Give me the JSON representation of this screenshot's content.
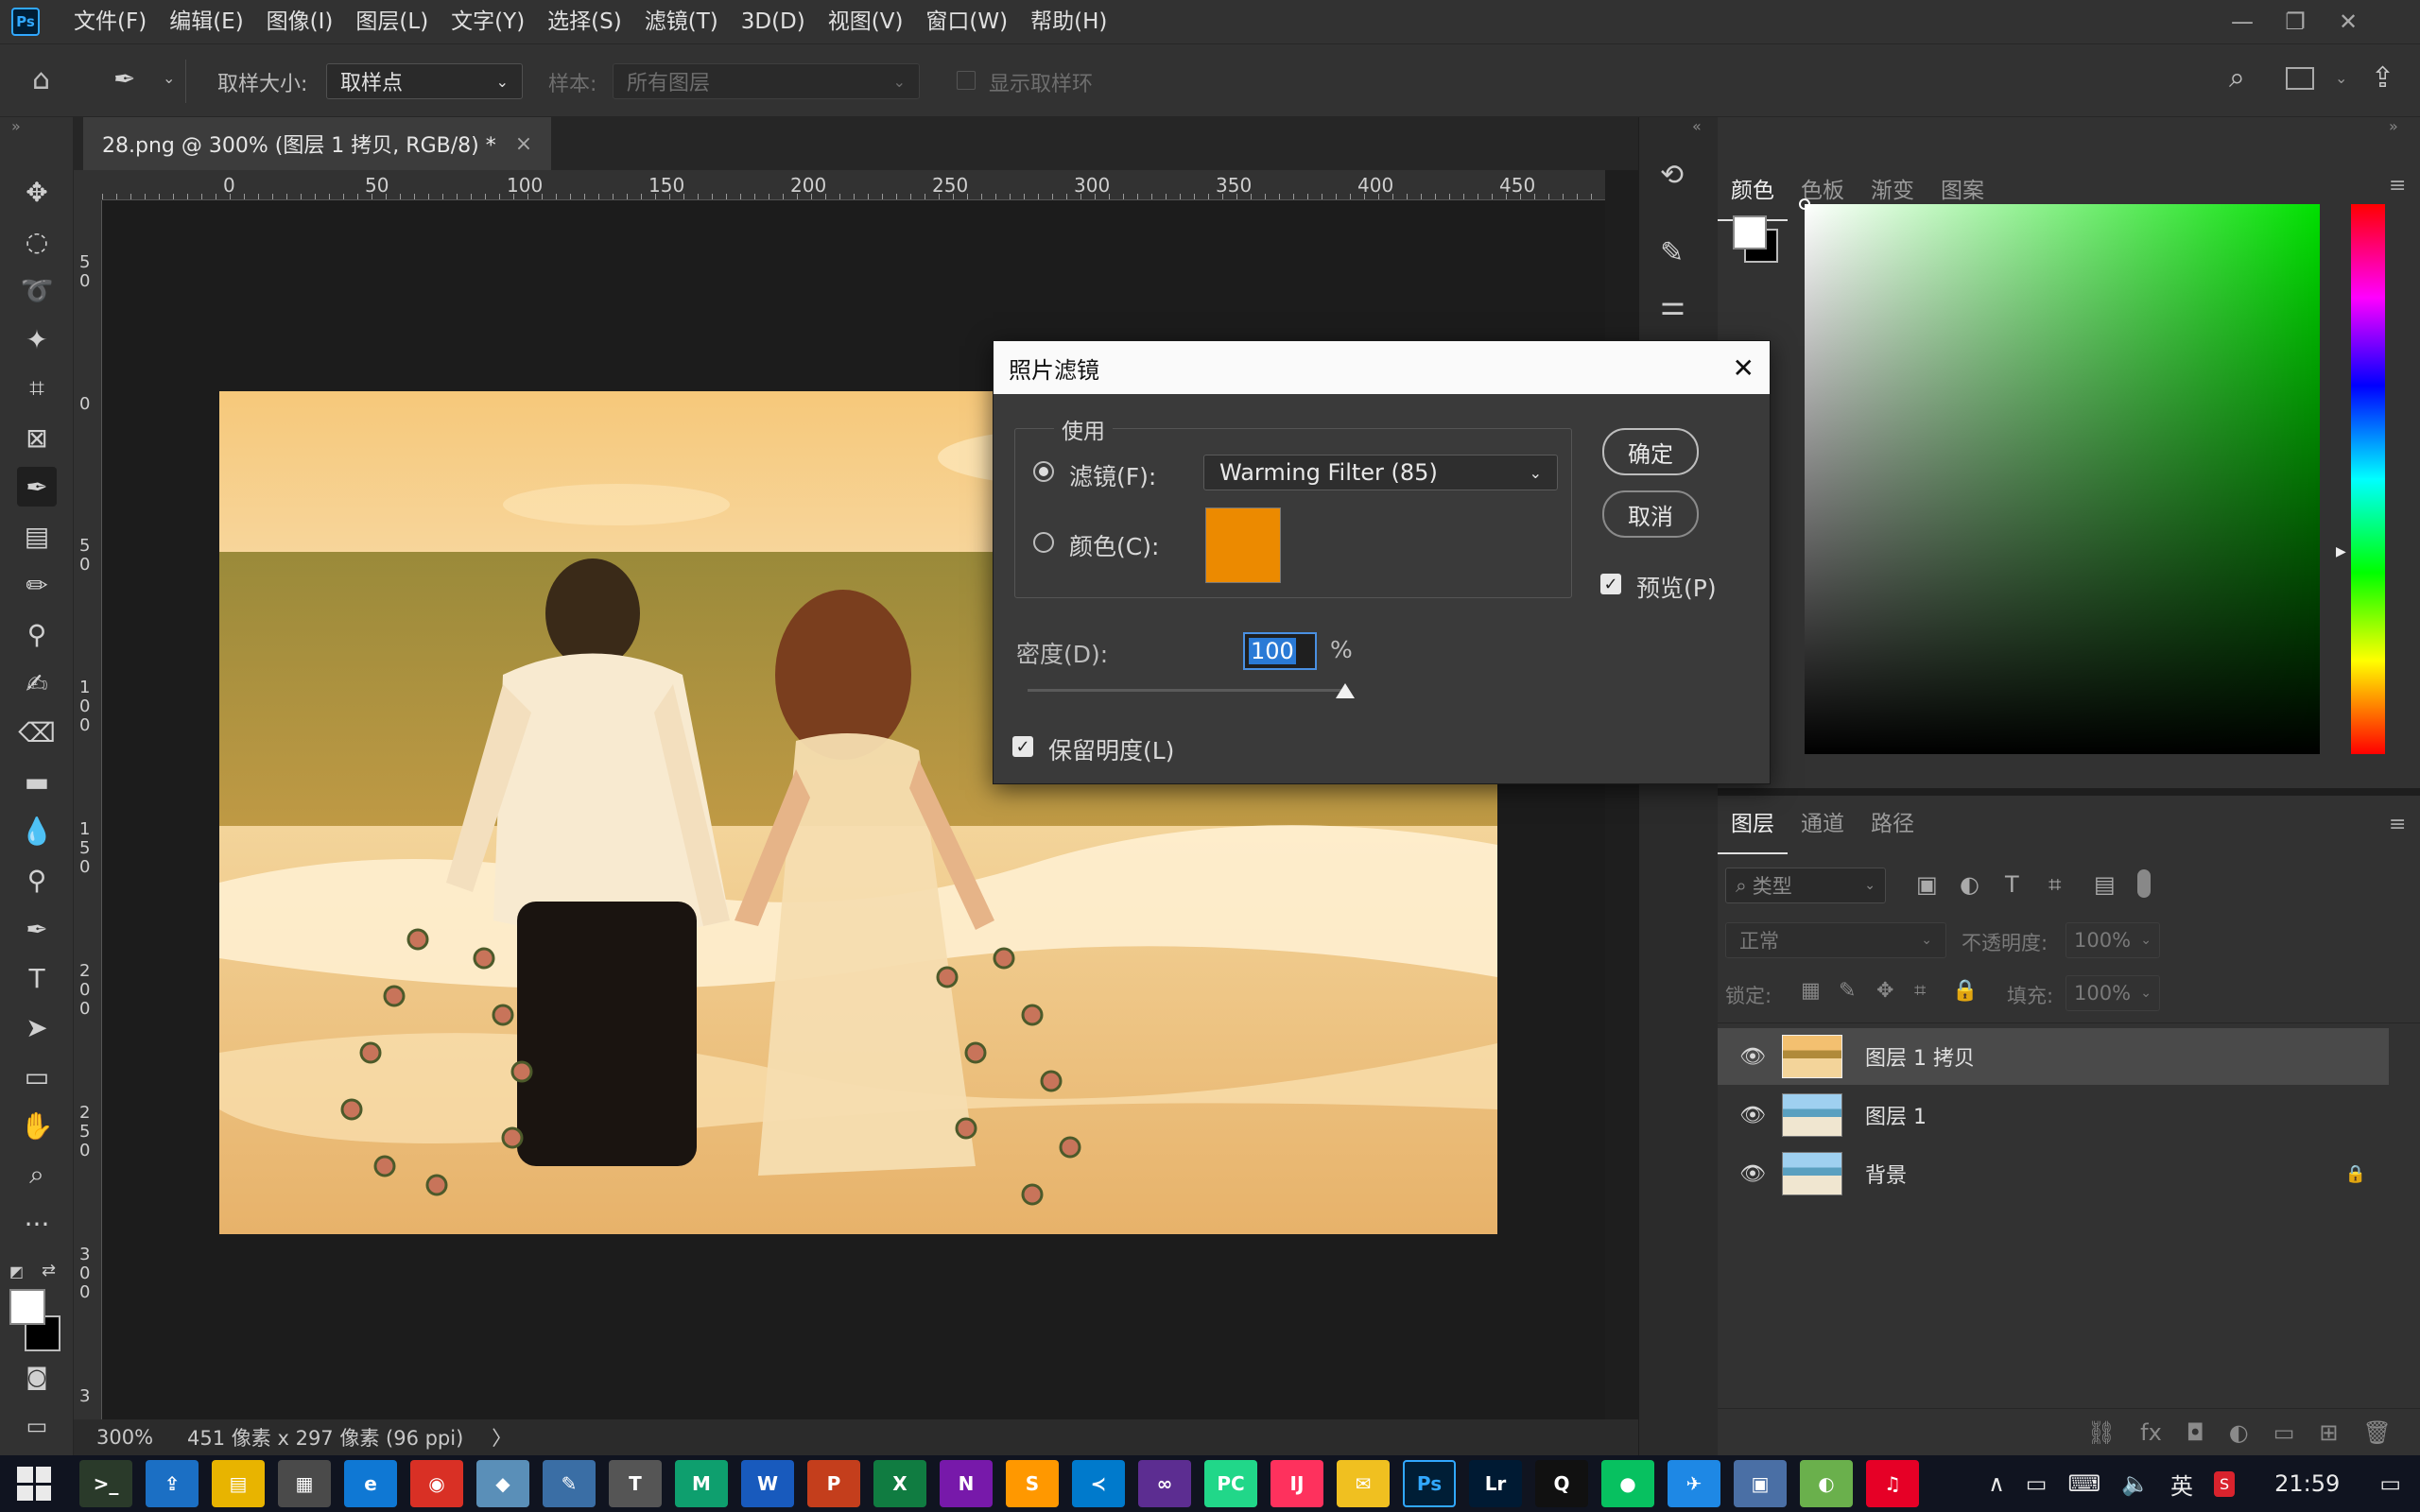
{
  "app": {
    "logo": "Ps",
    "name": "Photoshop"
  },
  "menu": [
    "文件(F)",
    "编辑(E)",
    "图像(I)",
    "图层(L)",
    "文字(Y)",
    "选择(S)",
    "滤镜(T)",
    "3D(D)",
    "视图(V)",
    "窗口(W)",
    "帮助(H)"
  ],
  "options": {
    "sample_size_label": "取样大小:",
    "sample_size_value": "取样点",
    "sample_label": "样本:",
    "sample_value": "所有图层",
    "show_ring_label": "显示取样环"
  },
  "document": {
    "tab_title": "28.png @ 300% (图层 1 拷贝, RGB/8) *",
    "tab_close": "×",
    "zoom": "300%",
    "info": "451 像素 x 297 像素 (96 ppi)",
    "info_arrow": "〉"
  },
  "ruler_top": [
    "0",
    "50",
    "100",
    "150",
    "200",
    "250",
    "300",
    "350",
    "400",
    "450"
  ],
  "ruler_left": [
    "5\n0",
    "0",
    "5\n0",
    "1\n0\n0",
    "1\n5\n0",
    "2\n0\n0",
    "2\n5\n0",
    "3\n0\n0",
    "3"
  ],
  "color_panel": {
    "tabs": [
      "颜色",
      "色板",
      "渐变",
      "图案"
    ],
    "foreground": "#ffffff",
    "background": "#000000",
    "hue_field": "#00e000"
  },
  "layers_panel": {
    "tabs": [
      "图层",
      "通道",
      "路径"
    ],
    "filter_kind": "类型",
    "blend_mode": "正常",
    "opacity_label": "不透明度:",
    "opacity_value": "100%",
    "lock_label": "锁定:",
    "fill_label": "填充:",
    "fill_value": "100%",
    "layers": [
      {
        "name": "图层 1 拷贝",
        "selected": true
      },
      {
        "name": "图层 1",
        "selected": false
      },
      {
        "name": "背景",
        "selected": false,
        "locked": true
      }
    ]
  },
  "dialog": {
    "title": "照片滤镜",
    "group_label": "使用",
    "filter_label": "滤镜(F):",
    "filter_value": "Warming Filter (85)",
    "color_label": "颜色(C):",
    "color_swatch": "#ec8a00",
    "density_label": "密度(D):",
    "density_value": "100",
    "density_unit": "%",
    "density_level": 1.0,
    "preserve_label": "保留明度(L)",
    "preserve_checked": true,
    "ok_label": "确定",
    "cancel_label": "取消",
    "preview_label": "预览(P)",
    "preview_checked": true
  },
  "taskbar": {
    "time": "21:59",
    "ime": "英",
    "apps": [
      {
        "name": "terminal-icon",
        "glyph": ">_",
        "color": "#2a3a2a"
      },
      {
        "name": "remote-icon",
        "glyph": "⇪",
        "color": "#1b6fc4"
      },
      {
        "name": "explorer-icon",
        "glyph": "▤",
        "color": "#e8b400"
      },
      {
        "name": "calculator-icon",
        "glyph": "▦",
        "color": "#4a4a4a"
      },
      {
        "name": "edge-icon",
        "glyph": "e",
        "color": "#0f78d4"
      },
      {
        "name": "chrome-icon",
        "glyph": "◉",
        "color": "#d93025"
      },
      {
        "name": "vm-icon",
        "glyph": "◆",
        "color": "#5a8fb8"
      },
      {
        "name": "paint-icon",
        "glyph": "✎",
        "color": "#3a6ea5"
      },
      {
        "name": "typora-icon",
        "glyph": "T",
        "color": "#555"
      },
      {
        "name": "mindmap-icon",
        "glyph": "M",
        "color": "#0e9f6e"
      },
      {
        "name": "word-icon",
        "glyph": "W",
        "color": "#185abd"
      },
      {
        "name": "powerpoint-icon",
        "glyph": "P",
        "color": "#c43e1c"
      },
      {
        "name": "excel-icon",
        "glyph": "X",
        "color": "#107c41"
      },
      {
        "name": "onenote-icon",
        "glyph": "N",
        "color": "#7719aa"
      },
      {
        "name": "sublime-icon",
        "glyph": "S",
        "color": "#ff9800"
      },
      {
        "name": "vscode-icon",
        "glyph": "≺",
        "color": "#007acc"
      },
      {
        "name": "visualstudio-icon",
        "glyph": "∞",
        "color": "#5c2d91"
      },
      {
        "name": "pycharm-icon",
        "glyph": "PC",
        "color": "#21d789"
      },
      {
        "name": "intellij-icon",
        "glyph": "IJ",
        "color": "#fe315d"
      },
      {
        "name": "notes-icon",
        "glyph": "✉",
        "color": "#f0c020"
      },
      {
        "name": "photoshop-icon",
        "glyph": "Ps",
        "color": "#001e36"
      },
      {
        "name": "lightroom-icon",
        "glyph": "Lr",
        "color": "#001a33"
      },
      {
        "name": "qq-icon",
        "glyph": "Q",
        "color": "#111"
      },
      {
        "name": "wechat-icon",
        "glyph": "●",
        "color": "#07c160"
      },
      {
        "name": "feishu-icon",
        "glyph": "✈",
        "color": "#1e88e5"
      },
      {
        "name": "store-icon",
        "glyph": "▣",
        "color": "#4a6fa5"
      },
      {
        "name": "browser360-icon",
        "glyph": "◐",
        "color": "#6ab04c"
      },
      {
        "name": "netease-music-icon",
        "glyph": "♫",
        "color": "#e60026"
      }
    ]
  }
}
